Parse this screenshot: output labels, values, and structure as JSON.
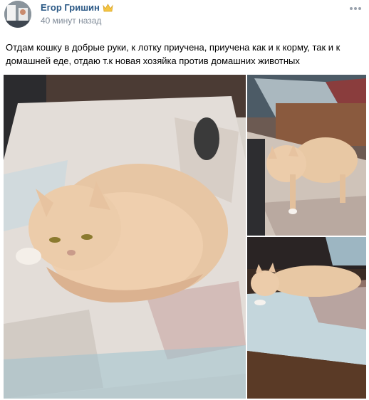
{
  "post": {
    "author": "Егор Гришин",
    "time": "40 минут назад",
    "text": "Отдам кошку в добрые руки, к лотку приучена, приучена как и к корму, так и к домашней еде, отдаю т.к новая хозяйка против домашних животных",
    "badge_icon": "crown-icon",
    "menu_icon": "more-dots-icon"
  },
  "colors": {
    "author": "#2a5885",
    "meta": "#818c99",
    "cat_fur": "#e7c6a4"
  }
}
